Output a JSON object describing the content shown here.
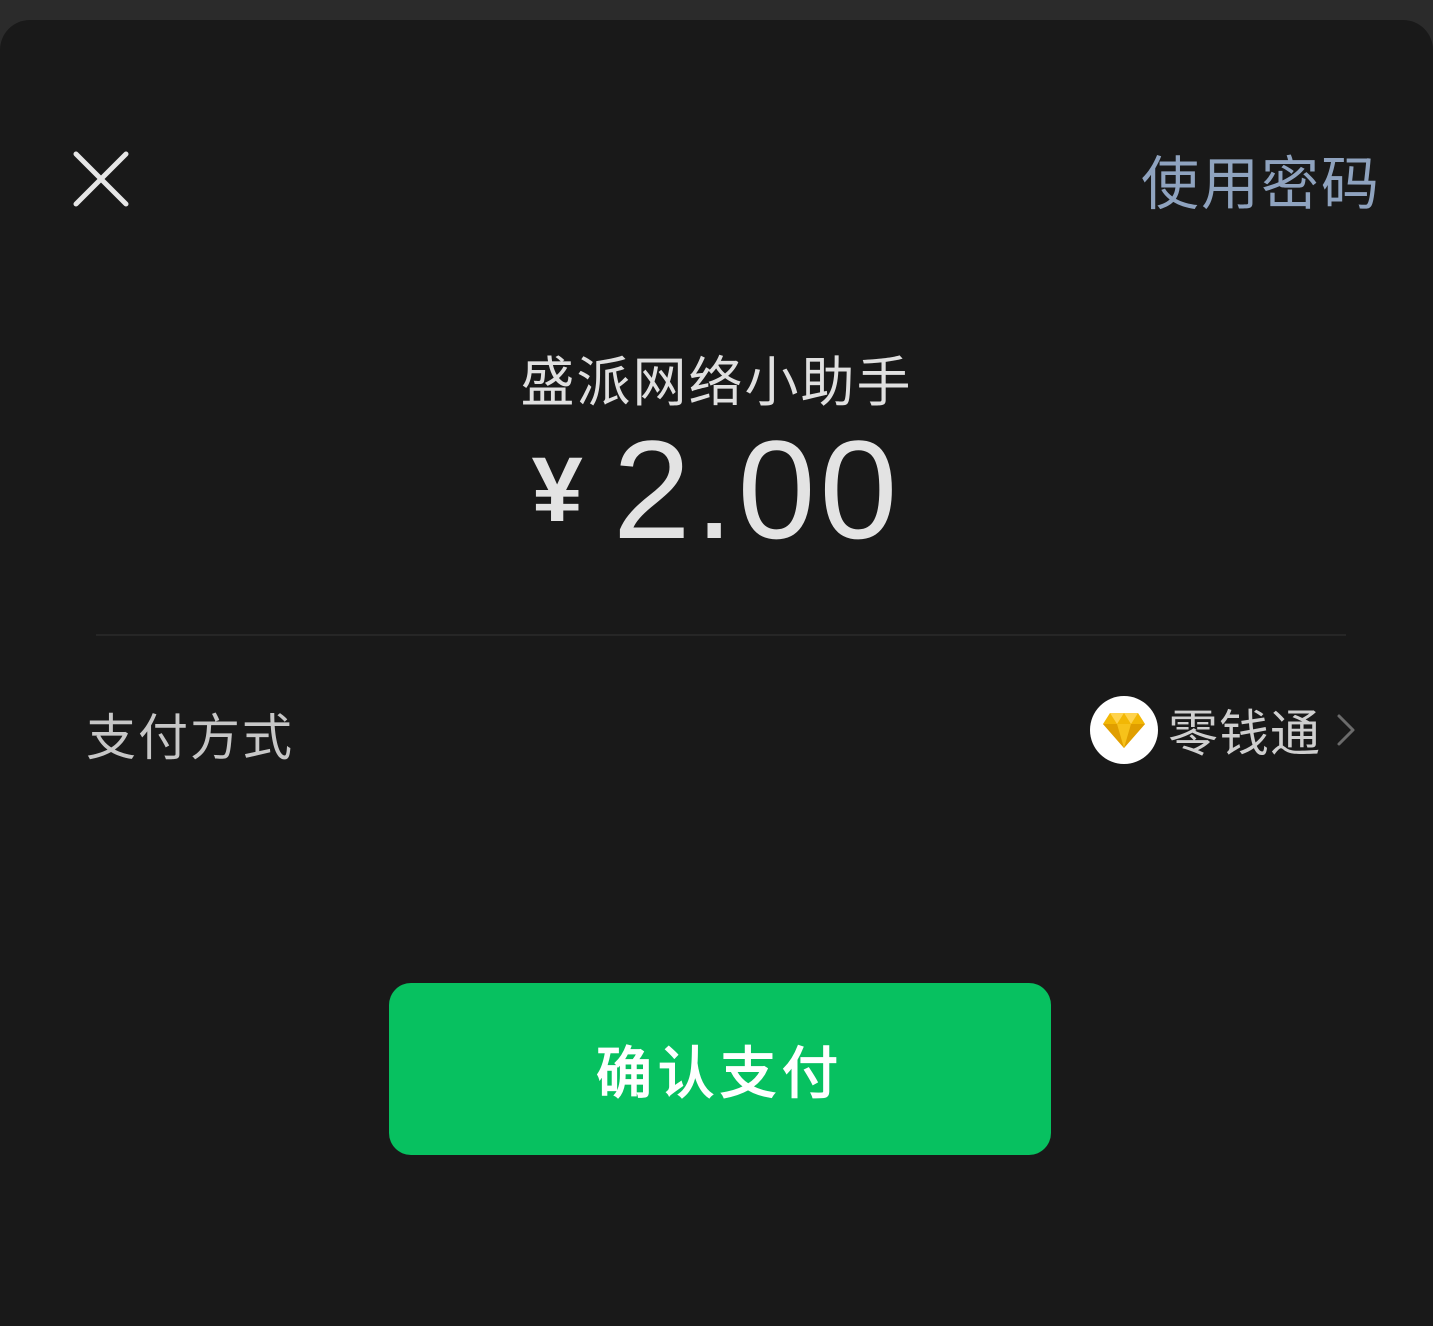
{
  "header": {
    "close_icon": "close-icon",
    "use_password_label": "使用密码"
  },
  "payment": {
    "merchant": "盛派网络小助手",
    "currency_symbol": "¥",
    "amount": "2.00"
  },
  "pay_method": {
    "label": "支付方式",
    "selected": "零钱通",
    "icon": "diamond-icon",
    "chevron_icon": "chevron-right-icon"
  },
  "confirm": {
    "label": "确认支付"
  },
  "colors": {
    "background": "#191919",
    "accent_green": "#07c160",
    "link_blue": "#8fa3bf",
    "diamond_gold": "#f2b705"
  }
}
